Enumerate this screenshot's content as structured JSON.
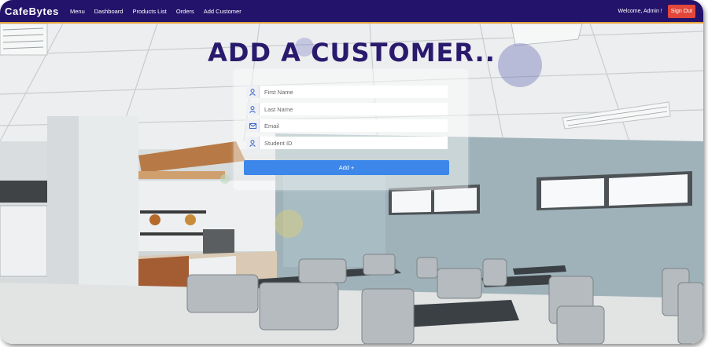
{
  "navbar": {
    "brand": "CafeBytes",
    "links": [
      "Menu",
      "Dashboard",
      "Products List",
      "Orders",
      "Add Customer"
    ],
    "welcome": "Welcome, Admin !",
    "signout": "Sign Out"
  },
  "form": {
    "title": "ADD A CUSTOMER..",
    "fields": [
      {
        "placeholder": "First Name",
        "icon": "user-icon"
      },
      {
        "placeholder": "Last Name",
        "icon": "user-icon"
      },
      {
        "placeholder": "Email",
        "icon": "envelope-icon"
      },
      {
        "placeholder": "Student ID",
        "icon": "user-icon"
      }
    ],
    "submit": "Add +"
  },
  "colors": {
    "navbar": "#23136b",
    "navbar_accent": "#e5a23a",
    "signout": "#e2473a",
    "primary_button": "#3d87ea",
    "title": "#2a1a6d"
  }
}
